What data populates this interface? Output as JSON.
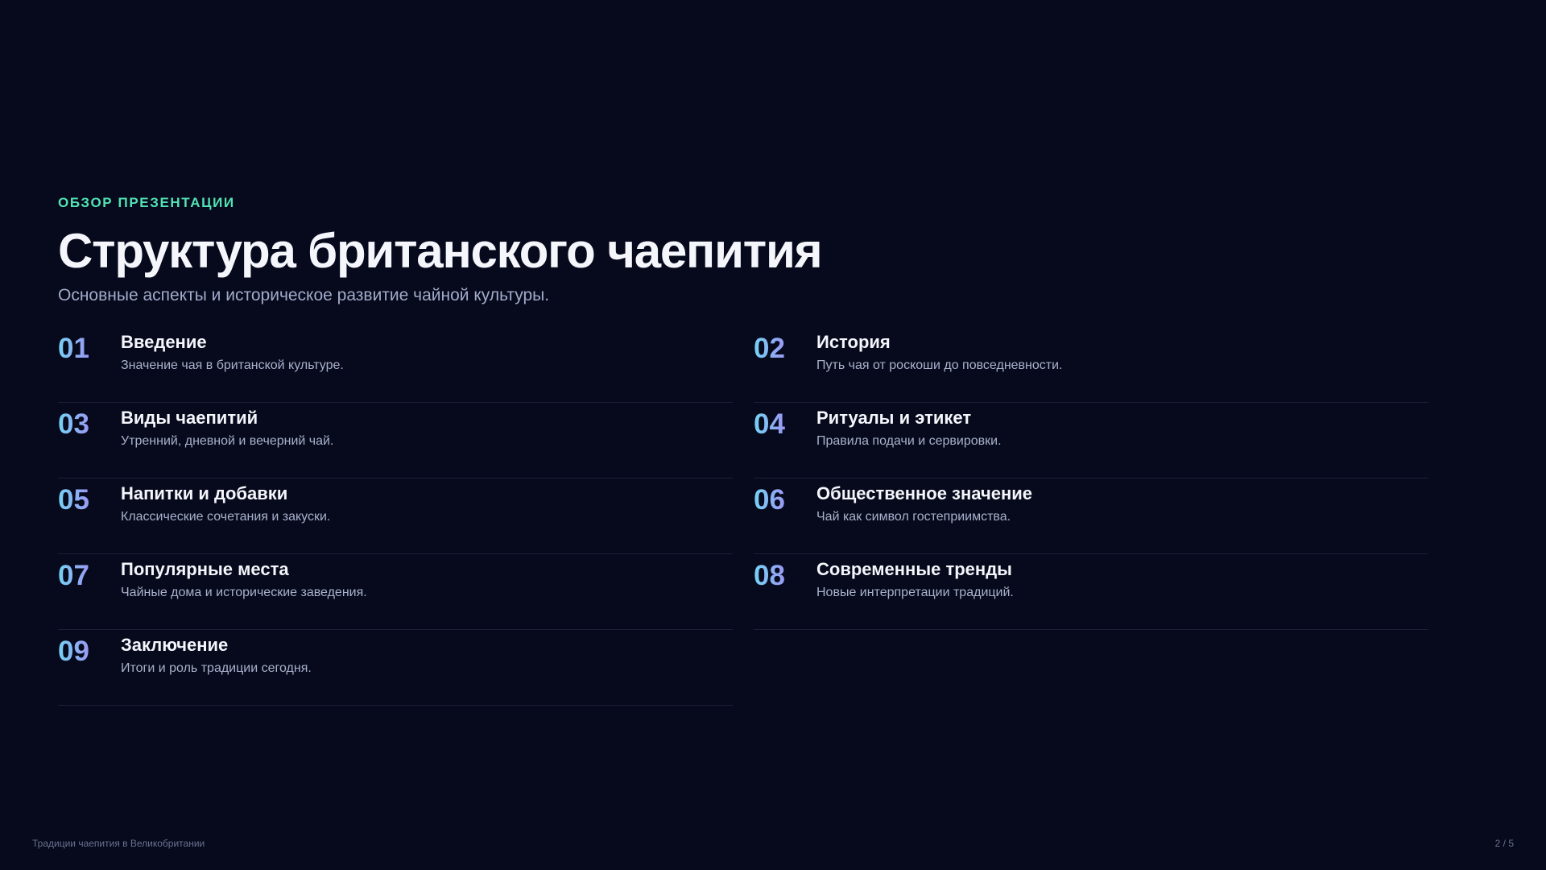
{
  "header": {
    "eyebrow": "ОБЗОР ПРЕЗЕНТАЦИИ",
    "title": "Структура британского чаепития",
    "subtitle": "Основные аспекты и историческое развитие чайной культуры."
  },
  "items": [
    {
      "number": "01",
      "title": "Введение",
      "description": "Значение чая в британской культуре."
    },
    {
      "number": "02",
      "title": "История",
      "description": "Путь чая от роскоши до повседневности."
    },
    {
      "number": "03",
      "title": "Виды чаепитий",
      "description": "Утренний, дневной и вечерний чай."
    },
    {
      "number": "04",
      "title": "Ритуалы и этикет",
      "description": "Правила подачи и сервировки."
    },
    {
      "number": "05",
      "title": "Напитки и добавки",
      "description": "Классические сочетания и закуски."
    },
    {
      "number": "06",
      "title": "Общественное значение",
      "description": "Чай как символ гостеприимства."
    },
    {
      "number": "07",
      "title": "Популярные места",
      "description": "Чайные дома и исторические заведения."
    },
    {
      "number": "08",
      "title": "Современные тренды",
      "description": "Новые интерпретации традиций."
    },
    {
      "number": "09",
      "title": "Заключение",
      "description": "Итоги и роль традиции сегодня."
    }
  ],
  "footer": {
    "presentation_title": "Традиции чаепития в Великобритании",
    "page_indicator": "2 / 5"
  },
  "colors": {
    "background": "#060a1c",
    "accent_eyebrow": "#52e3b4",
    "number_gradient_start": "#76d2f5",
    "number_gradient_end": "#9a98f3"
  }
}
